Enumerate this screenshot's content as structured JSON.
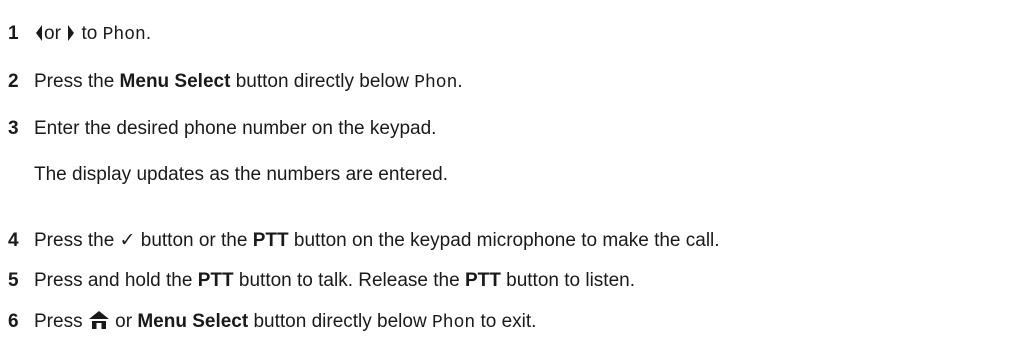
{
  "steps": [
    {
      "number": "1",
      "or_text": "or",
      "to_text": "to",
      "target": "Phon",
      "period": ".",
      "left_icon": "left-arrow-icon",
      "right_icon": "right-arrow-icon"
    },
    {
      "number": "2",
      "text_a": "Press the",
      "button_name": "Menu Select",
      "text_b": "button directly below",
      "target": "Phon",
      "period": "."
    },
    {
      "number": "3",
      "text": "Enter the desired phone number on the keypad.",
      "note": "The display updates as the numbers are entered."
    },
    {
      "number": "4",
      "text_a": "Press the",
      "check_glyph": "✓",
      "check_icon": "check-icon",
      "text_b": "button or the",
      "button_name": "PTT",
      "text_c": "button on the keypad microphone to make the call."
    },
    {
      "number": "5",
      "text_a": "Press and hold the",
      "button_name_1": "PTT",
      "text_b": "button to talk. Release the",
      "button_name_2": "PTT",
      "text_c": "button to listen."
    },
    {
      "number": "6",
      "text_a": "Press",
      "home_icon": "home-icon",
      "text_b": "or",
      "button_name": "Menu Select",
      "text_c": "button directly below",
      "target": "Phon",
      "text_d": "to exit."
    }
  ]
}
